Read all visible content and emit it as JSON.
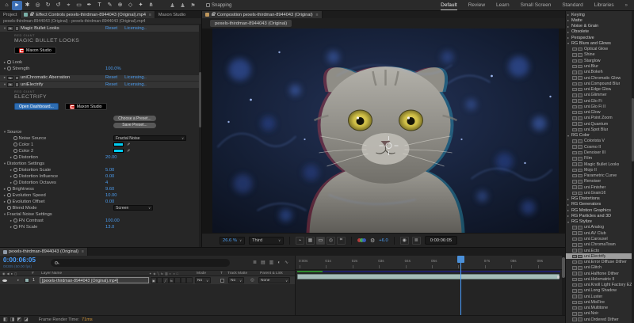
{
  "topbar": {
    "tools": [
      "home",
      "selection",
      "hand",
      "zoom",
      "orbit-camera",
      "rotation",
      "pan-behind",
      "rectangle",
      "pen",
      "type",
      "brush",
      "clone-stamp",
      "eraser",
      "roto-brush",
      "puppet-pin"
    ],
    "active_tool": "selection",
    "people_icons": [
      "user-presence",
      "user-presence",
      "share-screen"
    ],
    "snapping_label": "Snapping",
    "workspaces": [
      "Default",
      "Review",
      "Learn",
      "Small Screen",
      "Standard",
      "Libraries"
    ],
    "active_workspace": "Default",
    "workspace_overflow": "»"
  },
  "effect_controls": {
    "tabs": {
      "project": "Project",
      "effect_controls": "Effect Controls pexels-thirdman-8944043 (Original).mp4",
      "maxon": "Maxon Studio"
    },
    "subtitle": "pexels-thirdman-8944043 (Original) - pexels-thirdman-8944043 (Original).mp4",
    "rows": [
      {
        "type": "effect",
        "arrow": "v",
        "label": "Magic Bullet Looks",
        "links": [
          "Reset",
          "Licensing.."
        ]
      },
      {
        "type": "brand",
        "line1": "RED GIANT",
        "line2": "MAGIC BULLET LOOKS"
      },
      {
        "type": "buttons",
        "items": [
          {
            "label": "Maxon Studio",
            "style": "dark",
            "logo": true
          }
        ]
      },
      {
        "type": "gap",
        "h": 3
      },
      {
        "type": "param",
        "arrow": ">",
        "stopwatch": true,
        "label": "Look",
        "value": ""
      },
      {
        "type": "param",
        "arrow": "v",
        "stopwatch": true,
        "label": "Strength",
        "value": "100.0%"
      },
      {
        "type": "slider",
        "min": "0.0%",
        "max": "100.0%"
      },
      {
        "type": "gap",
        "h": 3
      },
      {
        "type": "effect",
        "arrow": ">",
        "label": "uniChromatic Aberration",
        "links": [
          "Reset",
          "Licensing.."
        ]
      },
      {
        "type": "effect",
        "arrow": "v",
        "label": "uniElectrify",
        "links": [
          "Reset",
          "Licensing.."
        ]
      },
      {
        "type": "brand",
        "line1": "RED GIANT",
        "line2": "ELECTRIFY"
      },
      {
        "type": "buttons",
        "items": [
          {
            "label": "Open Dashboard...",
            "style": "blue",
            "logo": false
          },
          {
            "label": "Maxon Studio",
            "style": "dark",
            "logo": true
          }
        ]
      },
      {
        "type": "gap",
        "h": 3
      },
      {
        "type": "preset",
        "label": "Choose a Preset..."
      },
      {
        "type": "preset",
        "label": "Save Preset..."
      },
      {
        "type": "group",
        "arrow": "v",
        "label": "Source"
      },
      {
        "type": "dropdown",
        "stopwatch": true,
        "label": "Noise Source",
        "value": "Fractal Noise",
        "width": 92,
        "indent": 2
      },
      {
        "type": "color",
        "label": "Color 1",
        "swatch": "#00cdf2",
        "indent": 2
      },
      {
        "type": "color",
        "label": "Color 2",
        "swatch": "#00cdf2",
        "indent": 2
      },
      {
        "type": "param",
        "arrow": ">",
        "stopwatch": true,
        "label": "Distortion",
        "value": "20.00",
        "indent": 2
      },
      {
        "type": "group",
        "arrow": "v",
        "label": "Distortion Settings"
      },
      {
        "type": "param",
        "arrow": ">",
        "stopwatch": true,
        "label": "Distortion Scale",
        "value": "5.00",
        "indent": 2
      },
      {
        "type": "param",
        "arrow": ">",
        "stopwatch": true,
        "label": "Distortion Influence",
        "value": "0.00",
        "indent": 2
      },
      {
        "type": "param",
        "arrow": ">",
        "stopwatch": true,
        "label": "Distortion Octaves",
        "value": "4",
        "indent": 2
      },
      {
        "type": "param",
        "arrow": ">",
        "stopwatch": true,
        "label": "Brightness",
        "value": "9.60"
      },
      {
        "type": "param",
        "arrow": ">",
        "stopwatch": true,
        "label": "Evolution Speed",
        "value": "10.00"
      },
      {
        "type": "param",
        "arrow": ">",
        "stopwatch": true,
        "label": "Evolution Offset",
        "value": "0.00"
      },
      {
        "type": "dropdown",
        "stopwatch": true,
        "label": "Blend Mode",
        "value": "Screen",
        "width": 50
      },
      {
        "type": "group",
        "arrow": "v",
        "label": "Fractal Noise Settings"
      },
      {
        "type": "param",
        "arrow": ">",
        "stopwatch": true,
        "label": "FN Contrast",
        "value": "100.00",
        "indent": 2
      },
      {
        "type": "param",
        "arrow": ">",
        "stopwatch": true,
        "label": "FN Scale",
        "value": "13.0",
        "indent": 2
      }
    ]
  },
  "composition": {
    "tab": "Composition pexels-thirdman-8944043 (Original)",
    "viewer_tab": "pexels-thirdman-8944043 (Original)",
    "toolbar": {
      "magnification": "26.6 %",
      "resolution": "Third",
      "exposure": "+6.0",
      "preview_time": "0:00:06:05",
      "icons_left": [
        "fast-previews",
        "transparency-grid",
        "region-of-interest",
        "mask-visibility",
        "view-options"
      ],
      "active_icon": "region-of-interest",
      "icons_right": [
        "snapshot-camera",
        "mini-flowchart"
      ]
    }
  },
  "timeline": {
    "tab": "pexels-thirdman-8944043 (Original)",
    "timecode": "0:00:06:05",
    "frame_info": "00305 (50.00 fps)",
    "right_icons": [
      "mini-flowchart",
      "draft-3d",
      "frame-blending",
      "motion-blur",
      "graph-editor"
    ],
    "av_header_icons": [
      "eye",
      "audio",
      "solo",
      "lock"
    ],
    "switch_header_icons": [
      "shy",
      "collapse",
      "quality",
      "effects",
      "frame-blend",
      "motion-blur",
      "adjustment",
      "3d"
    ],
    "columns": {
      "hash": "#",
      "layer_name": "Layer Name",
      "mode": "Mode",
      "t": "T",
      "track_matte": "Track Matte",
      "parent": "Parent & Link"
    },
    "layer": {
      "number": "1",
      "name": "[pexels-thirdman-8944043 (Original).mp4]",
      "switch_cells": [
        "▣",
        "",
        "╱",
        "fx",
        "",
        "",
        ""
      ],
      "mode": "No",
      "track_matte": "No",
      "parent": "None"
    },
    "ruler_ticks": [
      "0:00s",
      "01s",
      "02s",
      "03s",
      "04s",
      "05s",
      "06s",
      "07s",
      "08s",
      "09s"
    ],
    "bottom_icons": [
      "layer-switches-pane",
      "transfer-controls-pane",
      "in-out-pane",
      "render-time-pane"
    ],
    "status": {
      "frame_render_label": "Frame Render Time:",
      "frame_render_value": "71ms"
    }
  },
  "effects_panel": {
    "selected": "uni.Electrify",
    "groups": [
      {
        "label": "Keying",
        "expanded": false,
        "items": []
      },
      {
        "label": "Matte",
        "expanded": false,
        "items": []
      },
      {
        "label": "Noise & Grain",
        "expanded": false,
        "items": []
      },
      {
        "label": "Obsolete",
        "expanded": false,
        "items": []
      },
      {
        "label": "Perspective",
        "expanded": false,
        "items": []
      },
      {
        "label": "RG Blurs and Glows",
        "expanded": true,
        "items": [
          "Optical Glow",
          "Shine",
          "Starglow",
          "uni.Blur",
          "uni.Bokeh",
          "uni.Chromatic Glow",
          "uni.Compound Blur",
          "uni.Edge Glow",
          "uni.Glimmer",
          "uni.Glo Fi",
          "uni.Glo Fi II",
          "uni.Glow",
          "uni.Point Zoom",
          "uni.Quantum",
          "uni.Spot Blur"
        ]
      },
      {
        "label": "RG Color",
        "expanded": true,
        "items": [
          "Colorista V",
          "Cosmo II",
          "Denoiser III",
          "Film",
          "Magic Bullet Looks",
          "Mojo II",
          "Parametric Curve",
          "Renoiser",
          "uni.Finisher",
          "uni.Grain16"
        ]
      },
      {
        "label": "RG Distortions",
        "expanded": false,
        "items": []
      },
      {
        "label": "RG Generators",
        "expanded": false,
        "items": []
      },
      {
        "label": "RG Motion Graphics",
        "expanded": false,
        "items": []
      },
      {
        "label": "RG Particles and 3D",
        "expanded": false,
        "items": []
      },
      {
        "label": "RG Stylize",
        "expanded": true,
        "items": [
          "uni.Analog",
          "uni.AV Club",
          "uni.Carousel",
          "uni.ChromaTown",
          "uni.Ecto",
          "uni.Electrify",
          "uni.Error Diffuse Dither",
          "uni.Glitch",
          "uni.Halftone Dither",
          "uni.Holomatrix II",
          "uni.Knoll Light Factory EZ",
          "uni.Long Shadow",
          "uni.Luster",
          "uni.MisFire",
          "uni.Multitone",
          "uni.Noir",
          "uni.Ordered Dither"
        ]
      }
    ]
  },
  "colors": {
    "accent_blue": "#4c9df0",
    "timecode_blue": "#4ba0ff",
    "cache_green": "#2e8b2e",
    "layer_bar": "#a6bdb9",
    "render_time_orange": "#d89a3a",
    "electrify_cyan": "#00cdf2",
    "maxon_red": "#e02d28"
  }
}
